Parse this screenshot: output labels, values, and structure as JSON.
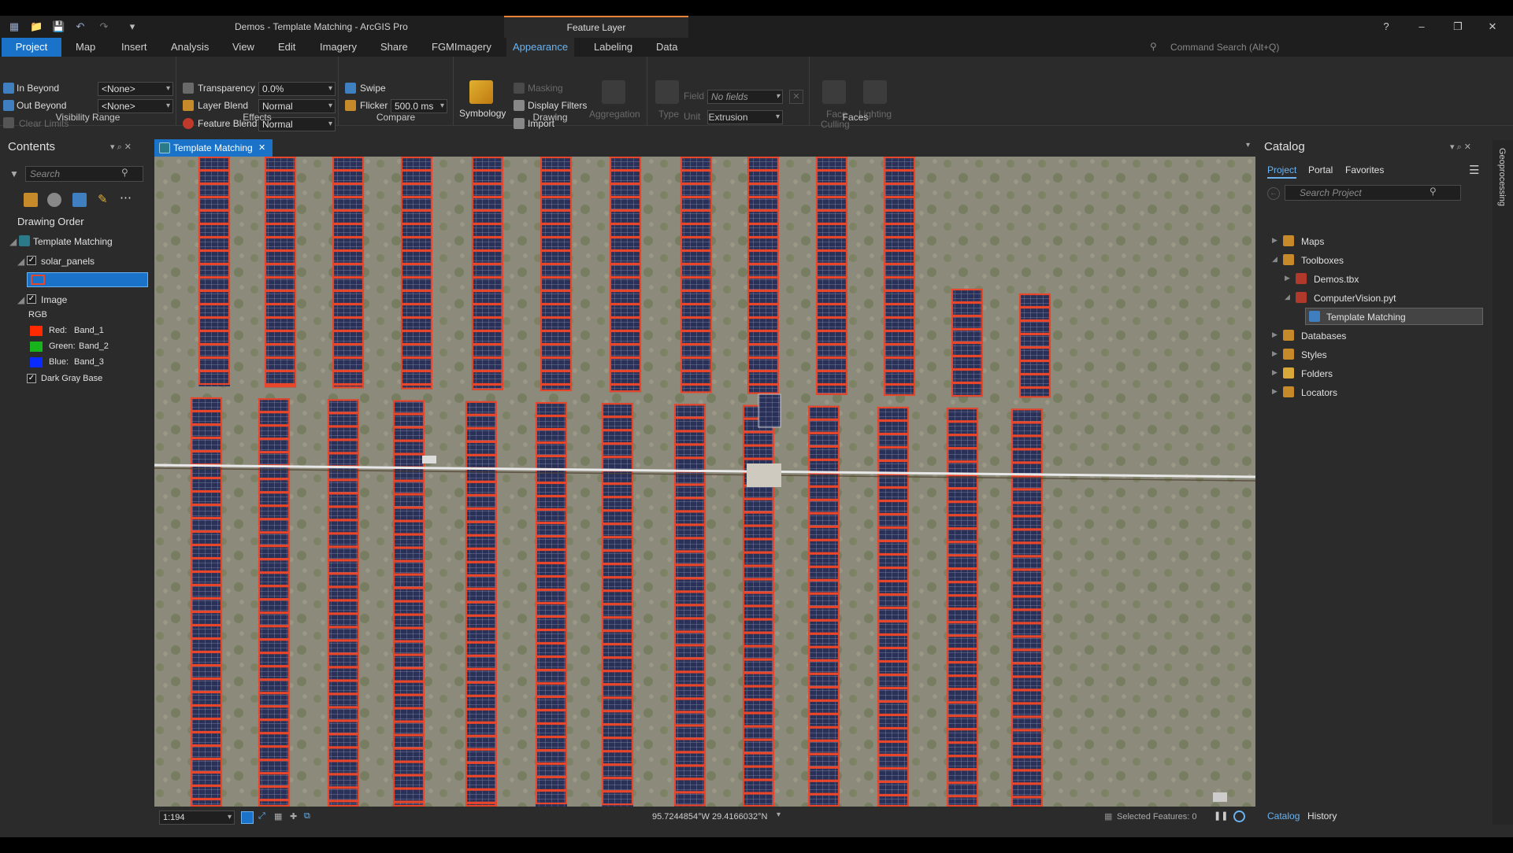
{
  "window": {
    "title": "Demos - Template Matching - ArcGIS Pro",
    "contextual_tab": "Feature Layer",
    "help": "?",
    "minimize": "–",
    "restore": "❐",
    "close": "✕"
  },
  "tabs": [
    "Project",
    "Map",
    "Insert",
    "Analysis",
    "View",
    "Edit",
    "Imagery",
    "Share",
    "FGMImagery",
    "Appearance",
    "Labeling",
    "Data"
  ],
  "command_search": {
    "placeholder": "Command Search (Alt+Q)"
  },
  "ribbon": {
    "visibility_range": {
      "label": "Visibility Range",
      "in_beyond": "In Beyond",
      "in_beyond_value": "<None>",
      "out_beyond": "Out Beyond",
      "out_beyond_value": "<None>",
      "clear_limits": "Clear Limits"
    },
    "effects": {
      "label": "Effects",
      "transparency": "Transparency",
      "transparency_value": "0.0%",
      "layer_blend": "Layer Blend",
      "layer_blend_value": "Normal",
      "feature_blend": "Feature Blend",
      "feature_blend_value": "Normal"
    },
    "compare": {
      "label": "Compare",
      "swipe": "Swipe",
      "flicker": "Flicker",
      "flicker_value": "500.0",
      "flicker_unit": "ms"
    },
    "drawing": {
      "label": "Drawing",
      "symbology": "Symbology",
      "masking": "Masking",
      "display_filters": "Display Filters",
      "import": "Import",
      "aggregation": "Aggregation"
    },
    "extrusion": {
      "label": "Extrusion",
      "type": "Type",
      "field": "Field",
      "field_value": "No fields",
      "unit": "Unit"
    },
    "faces": {
      "label": "Faces",
      "face_culling_1": "Face",
      "face_culling_2": "Culling",
      "lighting": "Lighting"
    }
  },
  "contents": {
    "title": "Contents",
    "search_placeholder": "Search",
    "drawing_order": "Drawing Order",
    "map_name": "Template Matching",
    "layer_1": "solar_panels",
    "layer_2": "Image",
    "rgb": "RGB",
    "red_label": "Red:",
    "red_band": "Band_1",
    "green_label": "Green:",
    "green_band": "Band_2",
    "blue_label": "Blue:",
    "blue_band": "Band_3",
    "basemap": "Dark Gray Base"
  },
  "map_view": {
    "tab_title": "Template Matching",
    "scale": "1:194",
    "coordinates": "95.7244854°W 29.4166032°N",
    "selected_features": "Selected Features: 0"
  },
  "catalog": {
    "title": "Catalog",
    "tabs": [
      "Project",
      "Portal",
      "Favorites"
    ],
    "search_placeholder": "Search Project",
    "items": {
      "maps": "Maps",
      "toolboxes": "Toolboxes",
      "demos_tbx": "Demos.tbx",
      "cv_pyt": "ComputerVision.pyt",
      "template_matching": "Template Matching",
      "databases": "Databases",
      "styles": "Styles",
      "folders": "Folders",
      "locators": "Locators"
    },
    "bottom_tabs": [
      "Catalog",
      "History"
    ]
  },
  "geoprocessing_tab": "Geoprocessing",
  "colors": {
    "accent": "#1a73c9",
    "contextual": "#e8833a",
    "detection_box": "#e8462a"
  }
}
